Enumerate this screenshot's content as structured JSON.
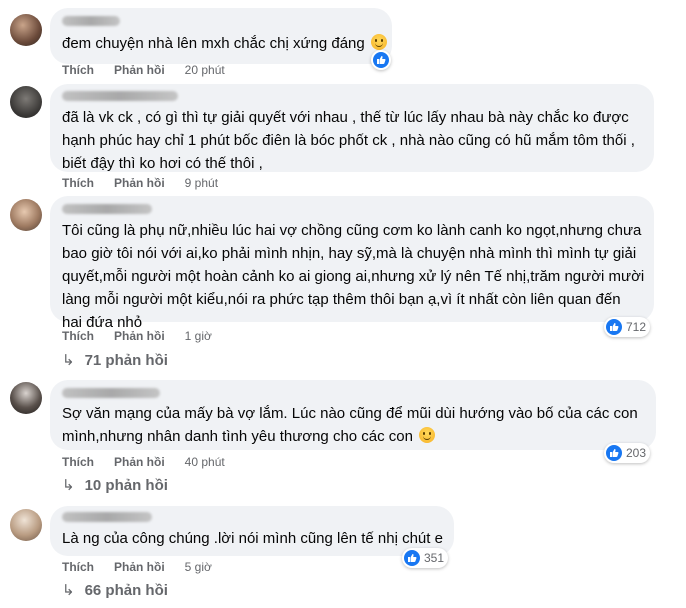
{
  "comments": [
    {
      "text": "đem chuyện nhà lên mxh chắc chị xứng đáng",
      "emoji": "slightly-smiling-face",
      "actions": {
        "like": "Thích",
        "reply": "Phản hồi",
        "time": "20 phút"
      },
      "reaction_count": ""
    },
    {
      "text": "đã là vk ck , có gì thì tự giải quyết với nhau , thế từ lúc lấy nhau bà này chắc ko được\nhạnh phúc hay chỉ 1 phút bốc điên là bóc phốt ck , nhà nào cũng có hũ mắm tôm thối ,\nbiết đậy thì ko hơi có thế thôi ,",
      "actions": {
        "like": "Thích",
        "reply": "Phản hồi",
        "time": "9 phút"
      }
    },
    {
      "text": "Tôi cũng là phụ nữ,nhiều lúc hai vợ chồng cũng cơm ko lành canh ko ngọt,nhưng chưa\nbao giờ tôi nói với ai,ko phải mình nhịn, hay sỹ,mà là chuyện nhà mình thì mình tự giải\nquyết,mỗi người một hoàn cảnh ko ai giong ai,nhưng xử lý nên Tế nhị,trăm người mười\nlàng mỗi người một kiểu,nói ra phức tạp thêm thôi bạn ạ,vì ít nhất còn liên quan đến\nhai đứa nhỏ",
      "actions": {
        "like": "Thích",
        "reply": "Phản hồi",
        "time": "1 giờ"
      },
      "reaction_count": "712",
      "replies": "71 phản hồi"
    },
    {
      "text": "Sợ văn mạng của mấy bà vợ lắm. Lúc nào cũng để mũi dùi hướng vào bố của các con\nmình,nhưng nhân danh tình yêu thương cho các con",
      "emoji": "slightly-smiling-face",
      "actions": {
        "like": "Thích",
        "reply": "Phản hồi",
        "time": "40 phút"
      },
      "reaction_count": "203",
      "replies": "10 phản hồi"
    },
    {
      "text": "Là ng của công chúng .lời nói mình cũng lên tế nhị chút e",
      "actions": {
        "like": "Thích",
        "reply": "Phản hồi",
        "time": "5 giờ"
      },
      "reaction_count": "351",
      "replies": "66 phản hồi"
    }
  ],
  "colors": {
    "bubble": "#f0f2f5",
    "like_blue": "#1877f2",
    "meta": "#65676b",
    "text": "#050505"
  }
}
